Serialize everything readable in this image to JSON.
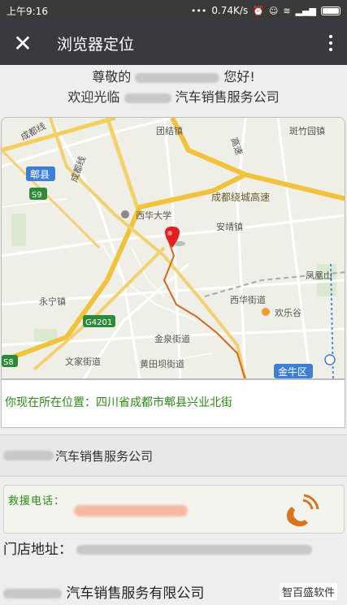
{
  "status_bar": {
    "time": "上午9:16",
    "network_speed": "0.74K/s"
  },
  "toolbar": {
    "title": "浏览器定位"
  },
  "welcome": {
    "greeting_prefix": "尊敬的",
    "greeting_suffix": "您好!",
    "welcome_prefix": "欢迎光临",
    "welcome_suffix": "汽车销售服务公司"
  },
  "map": {
    "labels": {
      "chengguanxian": "成都线",
      "tuanjiezhen": "团结镇",
      "gaosu": "高速",
      "banzhuyuanzhen": "斑竹园镇",
      "pixian": "郫县",
      "s9": "S9",
      "raocheng": "成都绕城高速",
      "xihuadaxue": "西华大学",
      "anjingzhen": "安靖镇",
      "fenghuangshan": "凤凰山",
      "yongningzhen": "永宁镇",
      "g4201": "G4201",
      "xihuajiedao": "西华街道",
      "huanlegu": "欢乐谷",
      "jinquanjiedao": "金泉街道",
      "s8": "S8",
      "wenjiajiedao": "文家街道",
      "huangtianbajiedao": "黄田坝街道",
      "jinniuqu": "金牛区",
      "chengdouxian": "成都线"
    }
  },
  "location": {
    "text": "你现在所在位置：四川省成都市郫县兴业北街"
  },
  "company": {
    "name_suffix": "汽车销售服务公司"
  },
  "rescue": {
    "label": "救援电话："
  },
  "address": {
    "label": "门店地址："
  },
  "footer": {
    "company_suffix": "汽车销售服务有限公司",
    "watermark": "智百盛软件"
  }
}
